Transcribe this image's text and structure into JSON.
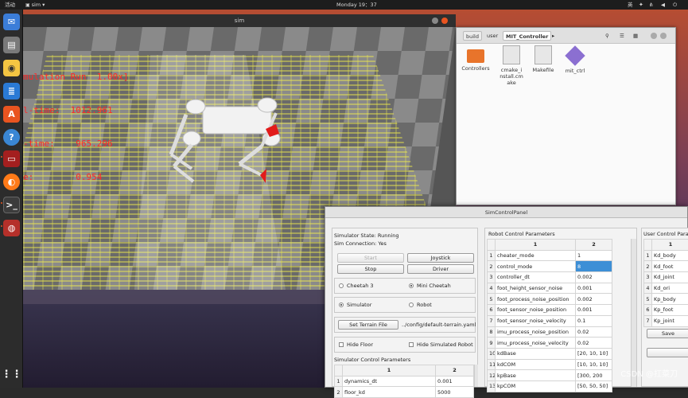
{
  "topbar": {
    "activities": "活动",
    "app": "sim",
    "clock": "Monday 19：37",
    "ime": "英"
  },
  "sim": {
    "title": "sim",
    "hud": [
      "mulation Run  1.00x]",
      "l-time:  1012.961",
      "-time:    965.296",
      "e:        0.954"
    ]
  },
  "filemanager": {
    "breadcrumb": [
      "build",
      "user",
      "MIT_Controller"
    ],
    "files": [
      {
        "name": "Controllers"
      },
      {
        "name": "cmake_install.cmake"
      },
      {
        "name": "Makefile"
      },
      {
        "name": "mit_ctrl"
      }
    ]
  },
  "panel": {
    "title": "SimControlPanel",
    "state": "Simulator State: Running",
    "connection": "Sim Connection: Yes",
    "buttons": {
      "start": "Start",
      "joystick": "Joystick",
      "stop": "Stop",
      "driver": "Driver"
    },
    "robots": {
      "cheetah3": "Cheetah 3",
      "mini": "Mini Cheetah"
    },
    "modes": {
      "simulator": "Simulator",
      "robot": "Robot"
    },
    "terrain": {
      "button": "Set Terrain File",
      "path": "../config/default-terrain.yaml"
    },
    "hide": {
      "floor": "Hide Floor",
      "robot": "Hide Simulated Robot"
    },
    "sim_params": {
      "title": "Simulator Control Parameters",
      "headers": [
        "1",
        "2"
      ],
      "rows": [
        [
          "1",
          "dynamics_dt",
          "0.001"
        ],
        [
          "2",
          "floor_kd",
          "5000"
        ]
      ]
    },
    "robot_params": {
      "title": "Robot Control Parameters",
      "headers": [
        "1",
        "2"
      ],
      "rows": [
        [
          "1",
          "cheater_mode",
          "1"
        ],
        [
          "2",
          "control_mode",
          "8"
        ],
        [
          "3",
          "controller_dt",
          "0.002"
        ],
        [
          "4",
          "foot_height_sensor_noise",
          "0.001"
        ],
        [
          "5",
          "foot_process_noise_position",
          "0.002"
        ],
        [
          "6",
          "foot_sensor_noise_position",
          "0.001"
        ],
        [
          "7",
          "foot_sensor_noise_velocity",
          "0.1"
        ],
        [
          "8",
          "imu_process_noise_position",
          "0.02"
        ],
        [
          "9",
          "imu_process_noise_velocity",
          "0.02"
        ],
        [
          "10",
          "kdBase",
          "[20, 10, 10]"
        ],
        [
          "11",
          "kdCOM",
          "[10, 10, 10]"
        ],
        [
          "12",
          "kpBase",
          "[300, 200"
        ],
        [
          "13",
          "kpCOM",
          "[50, 50, 50]"
        ]
      ]
    },
    "user_params": {
      "title": "User Control Param",
      "headers": [
        "1"
      ],
      "rows": [
        [
          "1",
          "Kd_body"
        ],
        [
          "2",
          "Kd_foot"
        ],
        [
          "3",
          "Kd_joint"
        ],
        [
          "4",
          "Kd_ori"
        ],
        [
          "5",
          "Kp_body"
        ],
        [
          "6",
          "Kp_foot"
        ],
        [
          "7",
          "Kp_joint"
        ]
      ],
      "save": "Save"
    }
  },
  "watermark": "CSDN @扛菜刀",
  "colors": {
    "accent": "#e95420",
    "selection": "#3d8fd6",
    "hud": "#ff2a2a"
  }
}
